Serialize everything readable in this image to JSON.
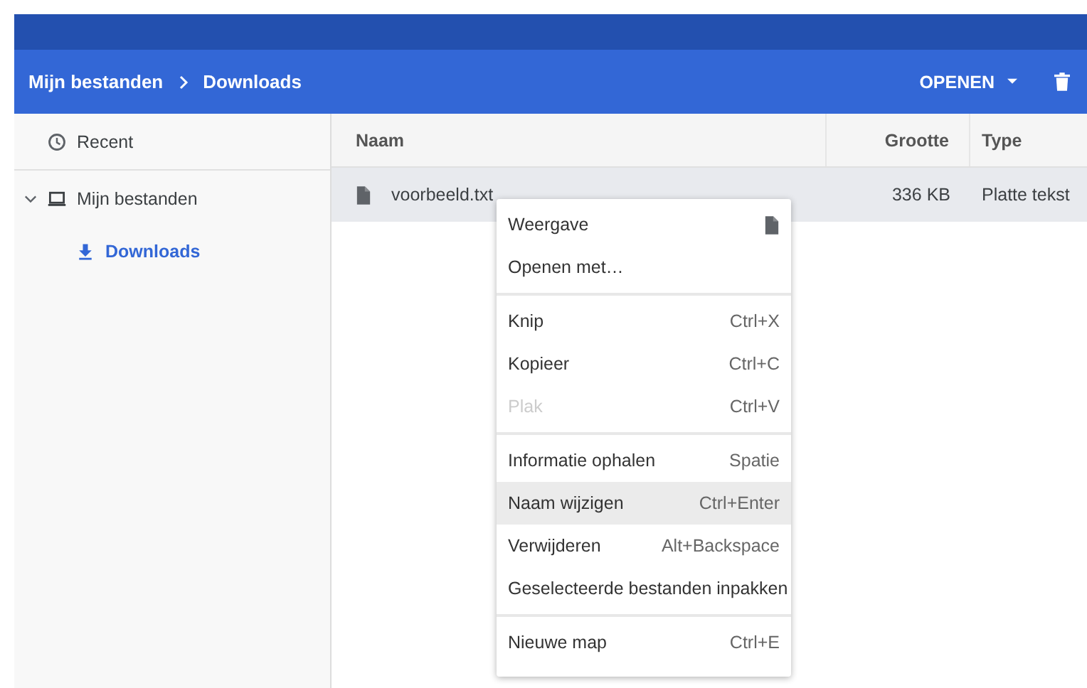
{
  "breadcrumb": [
    "Mijn bestanden",
    "Downloads"
  ],
  "toolbar": {
    "open_label": "OPENEN"
  },
  "sidebar": {
    "items": [
      {
        "label": "Recent",
        "kind": "recent",
        "selected": false
      },
      {
        "label": "Mijn bestanden",
        "kind": "computer",
        "selected": false,
        "expanded": true,
        "children": [
          {
            "label": "Downloads",
            "kind": "download",
            "selected": true
          }
        ]
      }
    ]
  },
  "table": {
    "columns": [
      "Naam",
      "Grootte",
      "Type"
    ],
    "rows": [
      {
        "name": "voorbeeld.txt",
        "size": "336 KB",
        "type": "Platte tekst",
        "selected": true
      }
    ]
  },
  "context_menu": {
    "groups": [
      [
        {
          "label": "Weergave",
          "kind": "icon",
          "disabled": false,
          "highlighted": false
        },
        {
          "label": "Openen met…",
          "kind": "plain",
          "disabled": false,
          "highlighted": false
        }
      ],
      [
        {
          "label": "Knip",
          "kind": "shortcut",
          "shortcut": "Ctrl+X",
          "disabled": false,
          "highlighted": false
        },
        {
          "label": "Kopieer",
          "kind": "shortcut",
          "shortcut": "Ctrl+C",
          "disabled": false,
          "highlighted": false
        },
        {
          "label": "Plak",
          "kind": "shortcut",
          "shortcut": "Ctrl+V",
          "disabled": true,
          "highlighted": false
        }
      ],
      [
        {
          "label": "Informatie ophalen",
          "kind": "shortcut",
          "shortcut": "Spatie",
          "disabled": false,
          "highlighted": false
        },
        {
          "label": "Naam wijzigen",
          "kind": "shortcut",
          "shortcut": "Ctrl+Enter",
          "disabled": false,
          "highlighted": true
        },
        {
          "label": "Verwijderen",
          "kind": "shortcut",
          "shortcut": "Alt+Backspace",
          "disabled": false,
          "highlighted": false
        },
        {
          "label": "Geselecteerde bestanden inpakken",
          "kind": "plain",
          "disabled": false,
          "highlighted": false
        }
      ],
      [
        {
          "label": "Nieuwe map",
          "kind": "shortcut",
          "shortcut": "Ctrl+E",
          "disabled": false,
          "highlighted": false
        }
      ]
    ]
  }
}
